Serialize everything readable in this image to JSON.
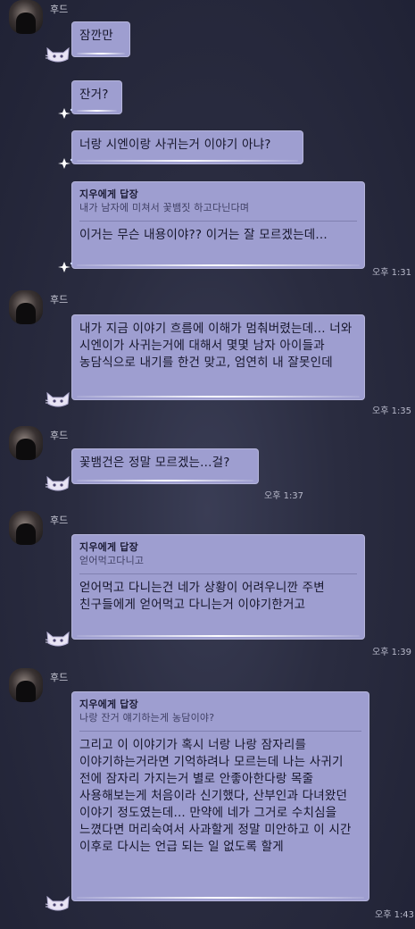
{
  "sender_name": "후드",
  "reply_label": "지우에게 답장",
  "messages": [
    {
      "text": "잠깐만"
    },
    {
      "text": "잔거?"
    },
    {
      "text": "너랑 시엔이랑 사귀는거 이야기 아냐?"
    },
    {
      "quote": "내가 남자에 미쳐서 꽃뱀짓 하고다닌다며",
      "text": "이거는 무슨 내용이야?? 이거는 잘 모르겠는데...",
      "time": "오후 1:31"
    },
    {
      "text": "내가 지금 이야기 흐름에 이해가 멈춰버렸는데... 너와 시엔이가 사귀는거에 대해서 몇몇 남자 아이들과 농담식으로 내기를 한건 맞고, 엄연히 내 잘못인데",
      "time": "오후 1:35"
    },
    {
      "text": "꽃뱀건은 정말 모르겠는...걸?",
      "time": "오후 1:37"
    },
    {
      "quote": "얻어먹고다니고",
      "text": "얻어먹고 다니는건 네가 상황이 어려우니깐 주변 친구들에게 얻어먹고 다니는거 이야기한거고",
      "time": "오후 1:39"
    },
    {
      "quote": "나랑 잔거 얘기하는게 농담이야?",
      "text": "그리고 이 이야기가 혹시 너랑 나랑 잠자리를 이야기하는거라면 기억하려나 모르는데 나는 사귀기 전에 잠자리 가지는거 별로 안좋아한다랑 목줄 사용해보는게 처음이라 신기했다, 산부인과 다녀왔던 이야기 정도였는데... 만약에 네가 그거로 수치심을 느꼈다면 머리숙여서 사과할게 정말 미안하고 이 시간 이후로 다시는 언급 되는 일 없도록 할게",
      "time": "오후 1:43"
    }
  ]
}
